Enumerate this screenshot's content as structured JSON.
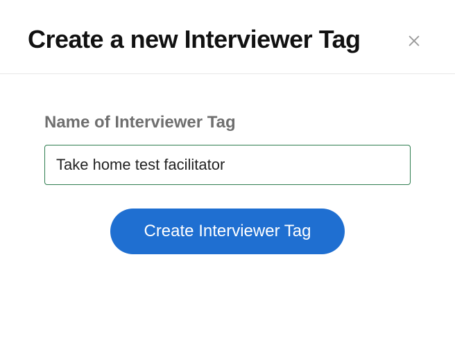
{
  "dialog": {
    "title": "Create a new Interviewer Tag",
    "close_label": "Close"
  },
  "form": {
    "name_label": "Name of Interviewer Tag",
    "name_value": "Take home test facilitator",
    "name_placeholder": ""
  },
  "actions": {
    "submit_label": "Create Interviewer Tag"
  },
  "colors": {
    "accent": "#1f6fd1",
    "input_border": "#2e7d4f",
    "label": "#6f6f6f"
  }
}
